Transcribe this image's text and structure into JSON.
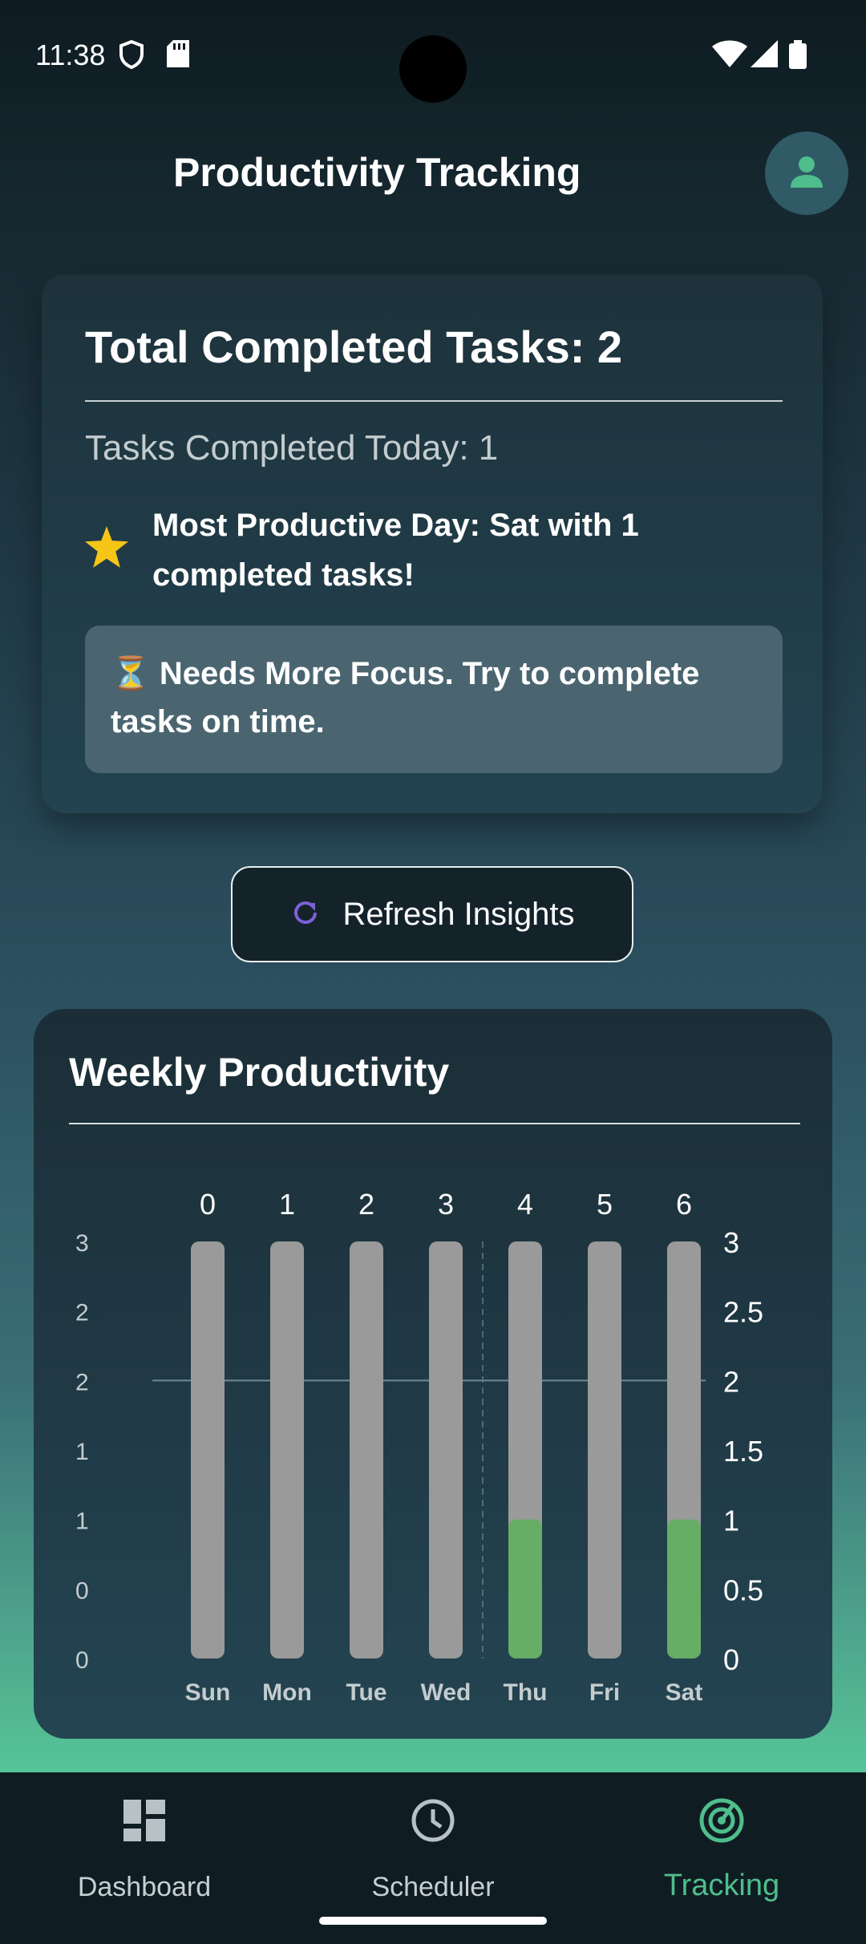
{
  "status_bar": {
    "time": "11:38"
  },
  "header": {
    "title": "Productivity Tracking"
  },
  "summary": {
    "total_completed": "Total Completed Tasks: 2",
    "today_completed": "Tasks Completed Today: 1",
    "most_productive": "Most Productive Day: Sat with 1 completed tasks!",
    "focus_message": "⏳ Needs More Focus. Try to complete tasks on time."
  },
  "refresh_button": {
    "label": "Refresh Insights"
  },
  "chart_card": {
    "title": "Weekly Productivity"
  },
  "chart_data": {
    "type": "bar",
    "title": "Weekly Productivity",
    "categories": [
      "Sun",
      "Mon",
      "Tue",
      "Wed",
      "Thu",
      "Fri",
      "Sat"
    ],
    "top_labels": [
      "0",
      "1",
      "2",
      "3",
      "4",
      "5",
      "6"
    ],
    "values": [
      0,
      0,
      0,
      0,
      1,
      0,
      1
    ],
    "background_max": 3,
    "ylim": [
      0,
      3
    ],
    "left_ticks": [
      "0",
      "0",
      "1",
      "1",
      "2",
      "2",
      "3"
    ],
    "right_ticks": [
      "0",
      "0.5",
      "1",
      "1.5",
      "2",
      "2.5",
      "3"
    ],
    "grid_y": 2,
    "colors": {
      "background_bar": "#9a9a9a",
      "value_bar": "#66ad66"
    }
  },
  "bottom_nav": {
    "items": [
      {
        "label": "Dashboard",
        "icon": "dashboard-icon",
        "active": false
      },
      {
        "label": "Scheduler",
        "icon": "clock-icon",
        "active": false
      },
      {
        "label": "Tracking",
        "icon": "tracking-icon",
        "active": true
      }
    ],
    "active_color": "#4fbe8c"
  }
}
